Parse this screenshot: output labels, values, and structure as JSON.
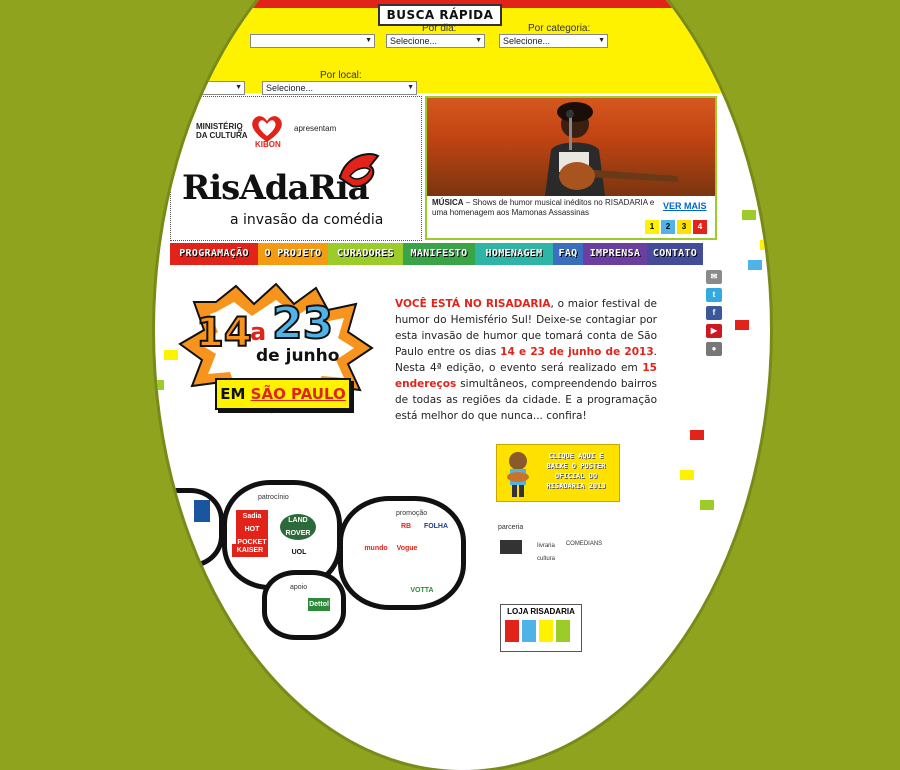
{
  "search": {
    "title": "BUSCA RÁPIDA",
    "by_day_label": "Por dia:",
    "by_category_label": "Por categoria:",
    "by_place_label": "Por local:",
    "select_placeholder": "Selecione..."
  },
  "sponsors_top": {
    "ministerio_line1": "MINISTÉRIO",
    "ministerio_line2": "DA CULTURA",
    "connector": "e",
    "kibon": "KIBON",
    "presentam": "apresentam"
  },
  "brand": {
    "name": "RisAdaRia",
    "tagline": "a invasão da comédia"
  },
  "slider": {
    "caption_category": "MÚSICA",
    "caption_text": " – Shows de humor musical inéditos no RISADARIA e uma homenagem aos Mamonas Assassinas",
    "more_link": "VER MAIS",
    "pages": [
      "1",
      "2",
      "3",
      "4"
    ]
  },
  "nav": {
    "items": [
      "PROGRAMAÇÃO",
      "O PROJETO",
      "CURADORES",
      "MANIFESTO",
      "HOMENAGEM",
      "FAQ",
      "IMPRENSA",
      "CONTATO"
    ],
    "colors": [
      "#e2231a",
      "#f39c12",
      "#9ccc2a",
      "#3aa547",
      "#2eb5a5",
      "#3a6fbf",
      "#6a3fa0",
      "#444c99"
    ]
  },
  "hero": {
    "day_from": "14",
    "connector": "a",
    "day_to": "23",
    "month": "de junho",
    "city_prefix": "EM",
    "city": "SÃO PAULO"
  },
  "intro": {
    "lead": "VOCÊ ESTÁ NO RISADARIA",
    "part1": ", o maior festival de humor do Hemisfério Sul! Deixe-se contagiar por esta invasão de humor que tomará conta de São Paulo entre os dias ",
    "dates": "14 e 23 de junho de 2013",
    "part2": ". Nesta 4ª edição, o evento será realizado em ",
    "venues": "15 endereços",
    "part3": " simultâneos, compreendendo bairros de todas as regiões da cidade. E a programação está melhor do que nunca... confira!"
  },
  "poster": {
    "text": "CLIQUE AQUI E BAIXE O POSTER OFICIAL DO RISADARIA 2013"
  },
  "partners": {
    "patrocinio_label": "patrocínio",
    "promocao_label": "promoção",
    "parceria_label": "parceria",
    "apoio_label": "apoio",
    "patrocinio_logos": [
      "Sadia HOT POCKET",
      "LAND ROVER",
      "KAISER",
      "UOL"
    ],
    "promocao_logos": [
      "RB",
      "FOLHA",
      "mundo",
      "Vogue",
      "VOTTA"
    ],
    "parceria_logos": [
      "livraria cultura",
      "COMEDIANS"
    ],
    "apoio_logos": [
      "Dettol"
    ]
  },
  "store": {
    "title": "LOJA RISADARIA"
  },
  "social": [
    "email",
    "twitter",
    "facebook",
    "youtube",
    "flickr"
  ],
  "colors": {
    "background": "#8fa31e",
    "yellow": "#fff200",
    "red": "#e2231a"
  }
}
